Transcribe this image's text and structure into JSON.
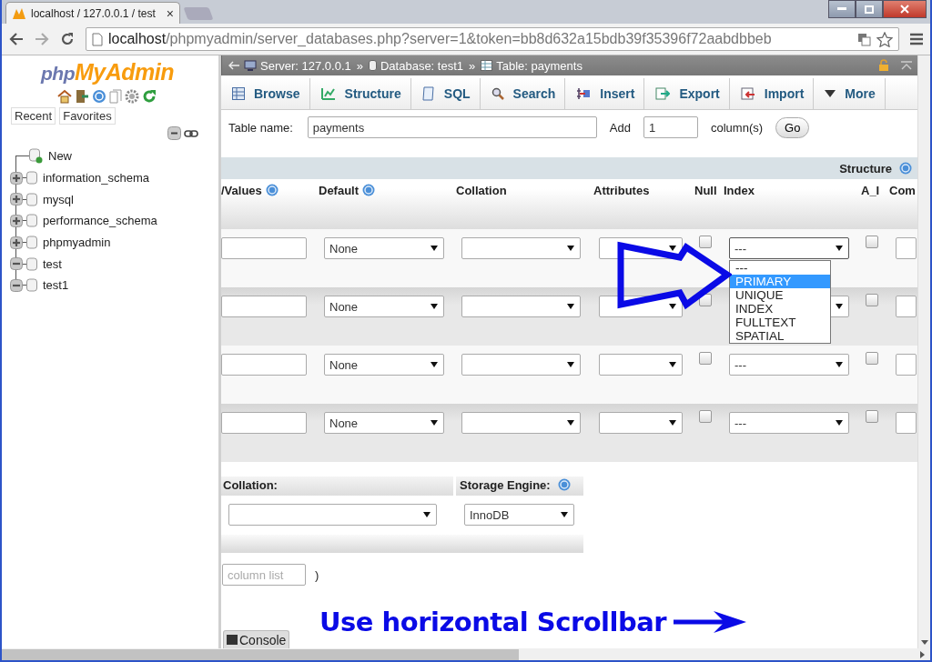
{
  "browser": {
    "tab": {
      "title": "localhost / 127.0.0.1 / test",
      "selected": true
    },
    "close": "×",
    "url": {
      "host": "localhost",
      "path": "/phpmyadmin/server_databases.php?server=1&token=bb8d632a15bdb39f35396f72aabdbbeb"
    }
  },
  "sidebar": {
    "logo": {
      "php": "php",
      "myadmin": "MyAdmin"
    },
    "buttons": [
      "Recent",
      "Favorites"
    ],
    "tree": [
      {
        "label": "New",
        "kind": "new"
      },
      {
        "label": "information_schema",
        "kind": "database",
        "expanded": false
      },
      {
        "label": "mysql",
        "kind": "database",
        "expanded": false
      },
      {
        "label": "performance_schema",
        "kind": "database",
        "expanded": false
      },
      {
        "label": "phpmyadmin",
        "kind": "database",
        "expanded": false
      },
      {
        "label": "test",
        "kind": "database",
        "expanded": true
      },
      {
        "label": "test1",
        "kind": "database",
        "expanded": true
      }
    ]
  },
  "breadcrumb": {
    "separator": "»",
    "items": [
      {
        "kind": "server",
        "label": "Server: 127.0.0.1"
      },
      {
        "kind": "database",
        "label": "Database: test1"
      },
      {
        "kind": "table",
        "label": "Table: payments"
      }
    ]
  },
  "tabs": [
    {
      "label": "Browse",
      "selected": false
    },
    {
      "label": "Structure",
      "selected": false
    },
    {
      "label": "SQL",
      "selected": false
    },
    {
      "label": "Search",
      "selected": false
    },
    {
      "label": "Insert",
      "selected": false
    },
    {
      "label": "Export",
      "selected": false
    },
    {
      "label": "Import",
      "selected": false
    },
    {
      "label": "More",
      "selected": false
    }
  ],
  "table_name_row": {
    "label": "Table name:",
    "value": "payments",
    "add_label": "Add",
    "add_value": "1",
    "unit": "column(s)",
    "button": "Go"
  },
  "structure": {
    "title": "Structure",
    "columns": [
      {
        "label": "/Values",
        "help": true
      },
      {
        "label": "Default",
        "help": true
      },
      {
        "label": "Collation",
        "help": false
      },
      {
        "label": "Attributes",
        "help": false
      },
      {
        "label": "Null",
        "help": false
      },
      {
        "label": "Index",
        "help": false
      },
      {
        "label": "A_I",
        "help": false
      },
      {
        "label": "Com",
        "help": false
      }
    ],
    "rows": [
      {
        "default": "None",
        "null": false,
        "index": "---",
        "a_i": false
      },
      {
        "default": "None",
        "null": false,
        "a_i": false
      },
      {
        "default": "None",
        "null": false,
        "index": "---",
        "a_i": false
      },
      {
        "default": "None",
        "null": false,
        "index": "---",
        "a_i": false
      }
    ]
  },
  "index_dropdown": {
    "options": [
      {
        "label": "---",
        "selected": false
      },
      {
        "label": "PRIMARY",
        "selected": true
      },
      {
        "label": "UNIQUE",
        "selected": false
      },
      {
        "label": "INDEX",
        "selected": false
      },
      {
        "label": "FULLTEXT",
        "selected": false
      },
      {
        "label": "SPATIAL",
        "selected": false
      }
    ]
  },
  "table_options": {
    "collation_label": "Collation:",
    "engine_label": "Storage Engine:",
    "engine": "InnoDB"
  },
  "partition": {
    "placeholder": "column list",
    "suffix": ")"
  },
  "console": "Console",
  "annotation": {
    "text": "Use horizontal Scrollbar"
  }
}
